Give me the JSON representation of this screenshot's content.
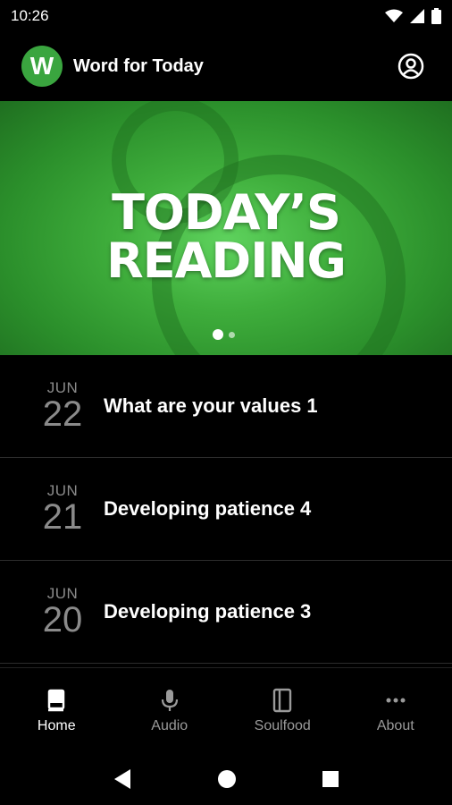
{
  "status": {
    "time": "10:26"
  },
  "appbar": {
    "logo_letter": "W",
    "title": "Word for Today"
  },
  "banner": {
    "line1": "TODAY’S",
    "line2": "READING"
  },
  "readings": [
    {
      "month": "JUN",
      "day": "22",
      "title": "What are your values 1"
    },
    {
      "month": "JUN",
      "day": "21",
      "title": "Developing patience 4"
    },
    {
      "month": "JUN",
      "day": "20",
      "title": "Developing patience 3"
    }
  ],
  "bottom_nav": [
    {
      "label": "Home",
      "icon": "book-icon",
      "active": true
    },
    {
      "label": "Audio",
      "icon": "microphone-icon"
    },
    {
      "label": "Soulfood",
      "icon": "notebook-icon"
    },
    {
      "label": "About",
      "icon": "more-horizontal-icon"
    }
  ],
  "colors": {
    "brand": "#3aa53f",
    "background": "#000000"
  }
}
